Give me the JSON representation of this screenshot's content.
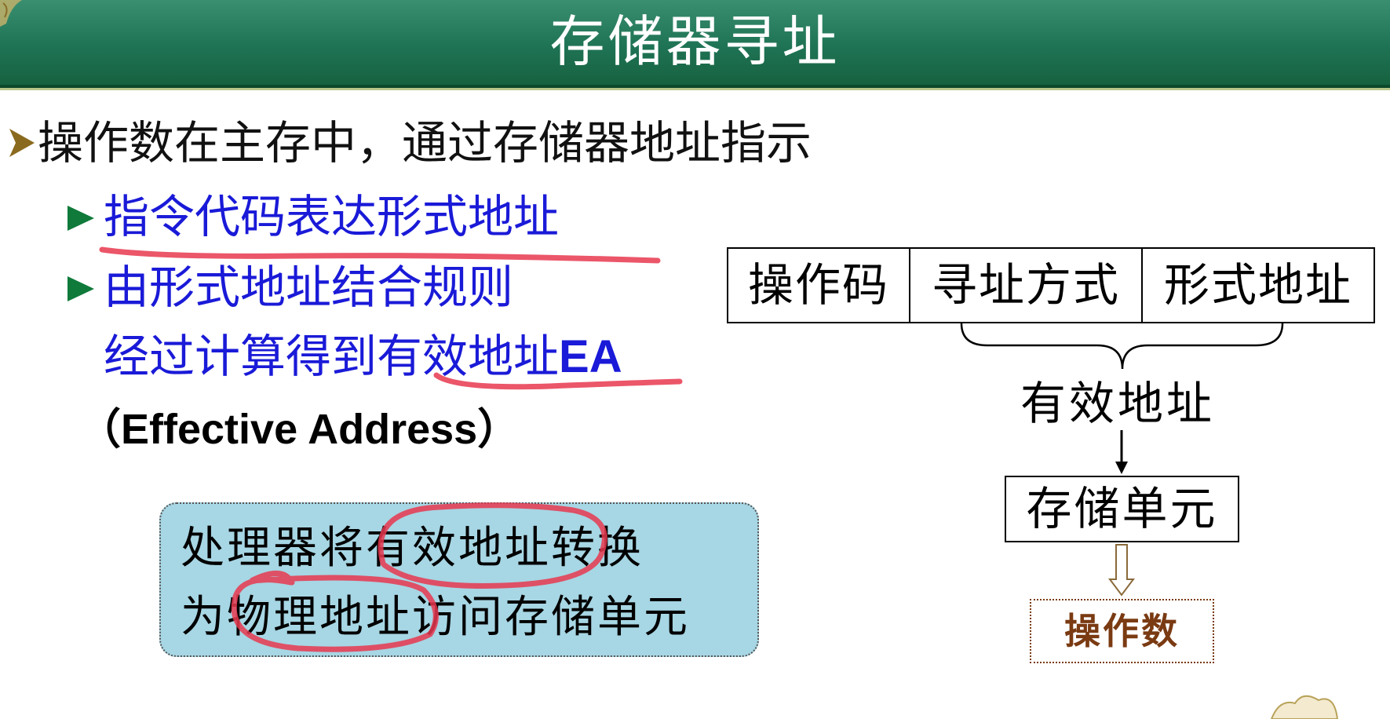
{
  "slide": {
    "title": "存储器寻址",
    "bullet_main": "操作数在主存中，通过存储器地址指示",
    "sub_items": [
      "指令代码表达形式地址",
      "由形式地址结合规则",
      "经过计算得到有效地址EA"
    ],
    "sub_item_3_text": "经过计算得到有效地址",
    "sub_item_3_suffix": "EA",
    "effective_address": "（Effective Address）",
    "note_lines": [
      "处理器将有效地址转换",
      "为物理地址访问存储单元"
    ]
  },
  "diagram": {
    "instruction_fields": [
      "操作码",
      "寻址方式",
      "形式地址"
    ],
    "effective_address_label": "有效地址",
    "storage_unit_label": "存储单元",
    "operand_label": "操作数"
  },
  "colors": {
    "header_green": "#1f7355",
    "sub_item_blue": "#1a1ad8",
    "note_bg": "#a7d6e4",
    "annotation_red": "#e8384f",
    "operand_brown": "#7a3a12"
  }
}
